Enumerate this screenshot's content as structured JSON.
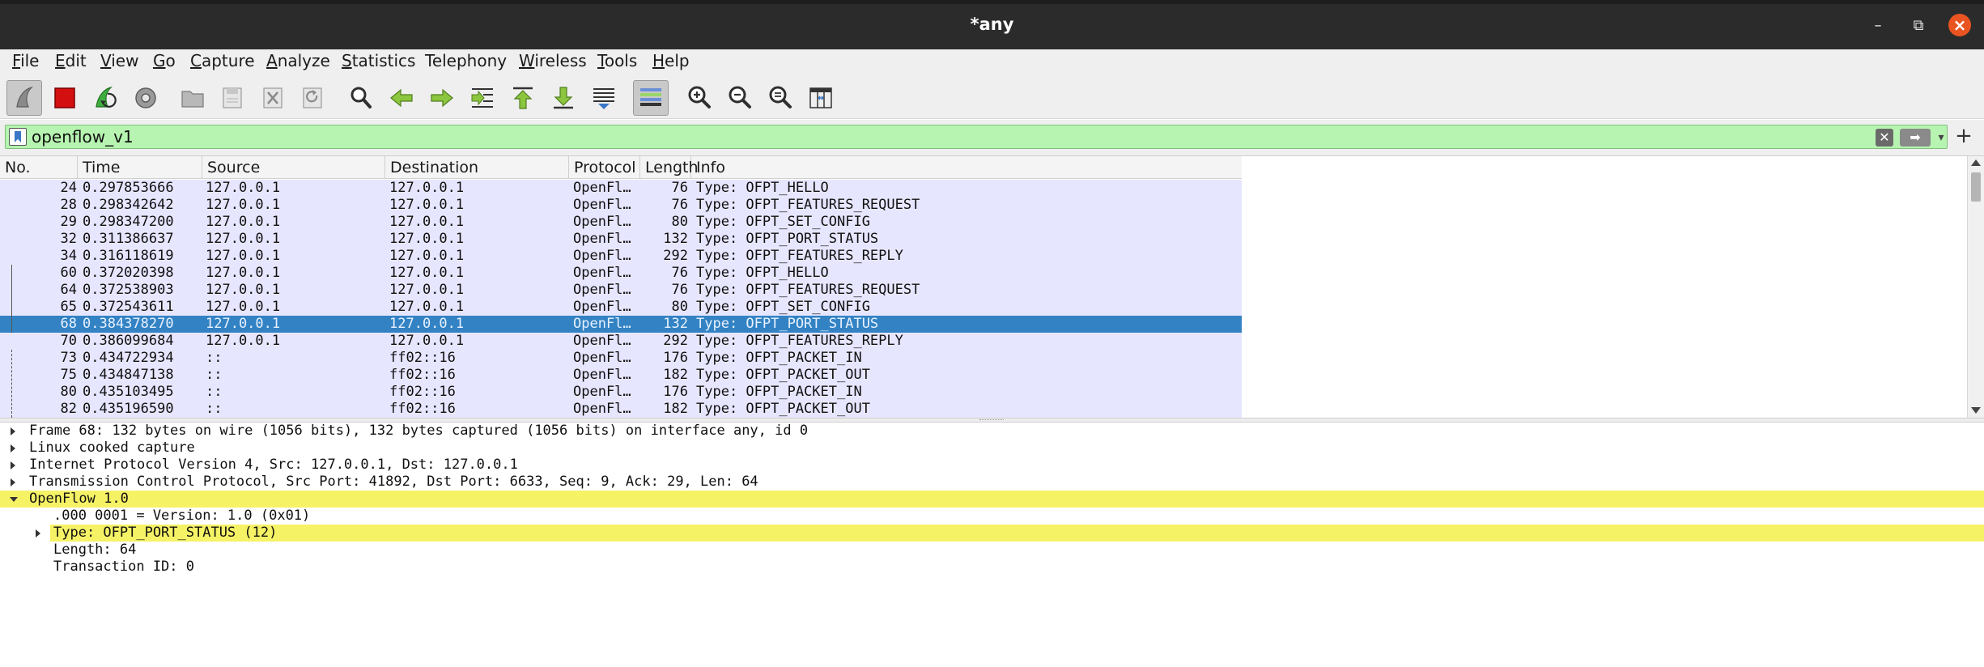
{
  "window": {
    "title": "*any",
    "minimize_glyph": "–",
    "maximize_glyph": "⧉",
    "close_glyph": "×"
  },
  "menu": [
    {
      "label": "File",
      "accel": "F",
      "rest": "ile"
    },
    {
      "label": "Edit",
      "accel": "E",
      "rest": "dit"
    },
    {
      "label": "View",
      "accel": "V",
      "rest": "iew"
    },
    {
      "label": "Go",
      "accel": "G",
      "rest": "o"
    },
    {
      "label": "Capture",
      "accel": "C",
      "rest": "apture"
    },
    {
      "label": "Analyze",
      "accel": "A",
      "rest": "nalyze"
    },
    {
      "label": "Statistics",
      "accel": "S",
      "rest": "tatistics"
    },
    {
      "label": "Telephony",
      "accel": "",
      "rest": "Telephony"
    },
    {
      "label": "Wireless",
      "accel": "W",
      "rest": "ireless"
    },
    {
      "label": "Tools",
      "accel": "T",
      "rest": "ools"
    },
    {
      "label": "Help",
      "accel": "H",
      "rest": "elp"
    }
  ],
  "toolbar_icons": [
    "start-capture-icon",
    "stop-capture-icon",
    "restart-capture-icon",
    "capture-options-icon",
    "open-file-icon",
    "save-file-icon",
    "close-file-icon",
    "reload-file-icon",
    "find-packet-icon",
    "go-back-icon",
    "go-forward-icon",
    "go-to-packet-icon",
    "first-packet-icon",
    "last-packet-icon",
    "auto-scroll-icon",
    "colorize-icon",
    "zoom-in-icon",
    "zoom-out-icon",
    "normal-size-icon",
    "resize-columns-icon"
  ],
  "filter": {
    "value": "openflow_v1",
    "clear_glyph": "✕",
    "apply_glyph": "➡",
    "dropdown_glyph": "▾",
    "add_glyph": "+"
  },
  "columns": {
    "no": "No.",
    "time": "Time",
    "source": "Source",
    "destination": "Destination",
    "protocol": "Protocol",
    "length": "Length",
    "info": "Info"
  },
  "packets": [
    {
      "no": "24",
      "time": "0.297853666",
      "src": "127.0.0.1",
      "dst": "127.0.0.1",
      "proto": "OpenFl…",
      "len": "76",
      "info": "Type: OFPT_HELLO"
    },
    {
      "no": "28",
      "time": "0.298342642",
      "src": "127.0.0.1",
      "dst": "127.0.0.1",
      "proto": "OpenFl…",
      "len": "76",
      "info": "Type: OFPT_FEATURES_REQUEST"
    },
    {
      "no": "29",
      "time": "0.298347200",
      "src": "127.0.0.1",
      "dst": "127.0.0.1",
      "proto": "OpenFl…",
      "len": "80",
      "info": "Type: OFPT_SET_CONFIG"
    },
    {
      "no": "32",
      "time": "0.311386637",
      "src": "127.0.0.1",
      "dst": "127.0.0.1",
      "proto": "OpenFl…",
      "len": "132",
      "info": "Type: OFPT_PORT_STATUS"
    },
    {
      "no": "34",
      "time": "0.316118619",
      "src": "127.0.0.1",
      "dst": "127.0.0.1",
      "proto": "OpenFl…",
      "len": "292",
      "info": "Type: OFPT_FEATURES_REPLY"
    },
    {
      "no": "60",
      "time": "0.372020398",
      "src": "127.0.0.1",
      "dst": "127.0.0.1",
      "proto": "OpenFl…",
      "len": "76",
      "info": "Type: OFPT_HELLO"
    },
    {
      "no": "64",
      "time": "0.372538903",
      "src": "127.0.0.1",
      "dst": "127.0.0.1",
      "proto": "OpenFl…",
      "len": "76",
      "info": "Type: OFPT_FEATURES_REQUEST"
    },
    {
      "no": "65",
      "time": "0.372543611",
      "src": "127.0.0.1",
      "dst": "127.0.0.1",
      "proto": "OpenFl…",
      "len": "80",
      "info": "Type: OFPT_SET_CONFIG"
    },
    {
      "no": "68",
      "time": "0.384378270",
      "src": "127.0.0.1",
      "dst": "127.0.0.1",
      "proto": "OpenFl…",
      "len": "132",
      "info": "Type: OFPT_PORT_STATUS",
      "selected": true
    },
    {
      "no": "70",
      "time": "0.386099684",
      "src": "127.0.0.1",
      "dst": "127.0.0.1",
      "proto": "OpenFl…",
      "len": "292",
      "info": "Type: OFPT_FEATURES_REPLY"
    },
    {
      "no": "73",
      "time": "0.434722934",
      "src": "::",
      "dst": "ff02::16",
      "proto": "OpenFl…",
      "len": "176",
      "info": "Type: OFPT_PACKET_IN"
    },
    {
      "no": "75",
      "time": "0.434847138",
      "src": "::",
      "dst": "ff02::16",
      "proto": "OpenFl…",
      "len": "182",
      "info": "Type: OFPT_PACKET_OUT"
    },
    {
      "no": "80",
      "time": "0.435103495",
      "src": "::",
      "dst": "ff02::16",
      "proto": "OpenFl…",
      "len": "176",
      "info": "Type: OFPT_PACKET_IN"
    },
    {
      "no": "82",
      "time": "0.435196590",
      "src": "::",
      "dst": "ff02::16",
      "proto": "OpenFl…",
      "len": "182",
      "info": "Type: OFPT_PACKET_OUT"
    }
  ],
  "details": [
    {
      "text": "Frame 68: 132 bytes on wire (1056 bits), 132 bytes captured (1056 bits) on interface any, id 0",
      "expander": "collapsed",
      "level": 0,
      "highlight": false
    },
    {
      "text": "Linux cooked capture",
      "expander": "collapsed",
      "level": 0,
      "highlight": false
    },
    {
      "text": "Internet Protocol Version 4, Src: 127.0.0.1, Dst: 127.0.0.1",
      "expander": "collapsed",
      "level": 0,
      "highlight": false
    },
    {
      "text": "Transmission Control Protocol, Src Port: 41892, Dst Port: 6633, Seq: 9, Ack: 29, Len: 64",
      "expander": "collapsed",
      "level": 0,
      "highlight": false
    },
    {
      "text": "OpenFlow 1.0",
      "expander": "expanded",
      "level": 0,
      "highlight": true
    },
    {
      "text": ".000 0001 = Version: 1.0 (0x01)",
      "expander": "none",
      "level": 1,
      "highlight": false
    },
    {
      "text": "Type: OFPT_PORT_STATUS (12)",
      "expander": "collapsed",
      "level": 1,
      "highlight": true
    },
    {
      "text": "Length: 64",
      "expander": "none",
      "level": 1,
      "highlight": false
    },
    {
      "text": "Transaction ID: 0",
      "expander": "none",
      "level": 1,
      "highlight": false
    }
  ],
  "colors": {
    "row_bg": "#e7e6ff",
    "selected_row": "#3383c4",
    "filter_valid": "#b7f4b1",
    "detail_highlight": "#f6f266",
    "close_button": "#e95420"
  }
}
